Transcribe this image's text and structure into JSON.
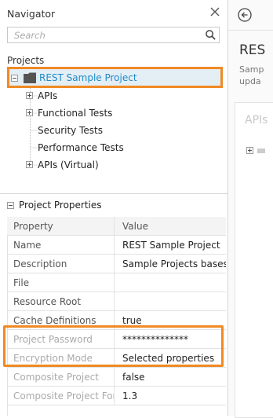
{
  "navigator": {
    "title": "Navigator",
    "search_placeholder": "Search",
    "projects_label": "Projects",
    "root": {
      "label": "REST Sample Project",
      "expanded": true
    },
    "children": [
      {
        "label": "APIs",
        "expandable": true
      },
      {
        "label": "Functional Tests",
        "expandable": true
      },
      {
        "label": "Security Tests",
        "expandable": false
      },
      {
        "label": "Performance Tests",
        "expandable": false
      },
      {
        "label": "APIs (Virtual)",
        "expandable": true
      }
    ]
  },
  "properties": {
    "header": "Project Properties",
    "columns": [
      "Property",
      "Value"
    ],
    "rows": [
      {
        "property": "Name",
        "value": "REST Sample Project"
      },
      {
        "property": "Description",
        "value": "Sample Projects bases..."
      },
      {
        "property": "File",
        "value": ""
      },
      {
        "property": "Resource Root",
        "value": ""
      },
      {
        "property": "Cache Definitions",
        "value": "true"
      },
      {
        "property": "Project Password",
        "value": "**************"
      },
      {
        "property": "Encryption Mode",
        "value": "Selected properties"
      },
      {
        "property": "Composite Project",
        "value": "false"
      },
      {
        "property": "Composite Project For...",
        "value": "1.3"
      }
    ]
  },
  "right": {
    "title": "RES",
    "sub1": "Samp",
    "sub2": "upda",
    "section": "APIs"
  },
  "colors": {
    "highlight": "#f08a24",
    "link": "#1f8cc9",
    "selection": "#e4eef5"
  }
}
